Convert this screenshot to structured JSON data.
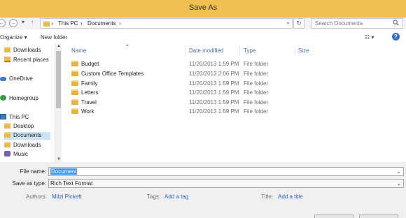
{
  "window": {
    "title": "Save As"
  },
  "nav": {
    "back_glyph": "←",
    "forward_glyph": "→",
    "recent_glyph": "▾",
    "up_glyph": "↑",
    "refresh_glyph": "↻",
    "crumbs": [
      {
        "label": "This PC"
      },
      {
        "label": "Documents"
      }
    ],
    "separator_glyph": "›",
    "dropdown_glyph": "⌄",
    "search_placeholder": "Search Documents",
    "search_icon": "search-icon"
  },
  "toolbar": {
    "organize_label": "Organize ▾",
    "new_folder_label": "New folder",
    "view_glyph": "☷ ▾",
    "help_glyph": "?"
  },
  "sidebar": {
    "items": [
      {
        "label": "Downloads",
        "icon": "folder-icon"
      },
      {
        "label": "Recent places",
        "icon": "recent-places-icon"
      },
      {
        "label": "OneDrive",
        "icon": "cloud-icon"
      },
      {
        "label": "Homegroup",
        "icon": "homegroup-icon"
      },
      {
        "label": "This PC",
        "icon": "computer-icon"
      },
      {
        "label": "Desktop",
        "icon": "folder-icon"
      },
      {
        "label": "Documents",
        "icon": "folder-icon",
        "selected": true
      },
      {
        "label": "Downloads",
        "icon": "folder-icon"
      },
      {
        "label": "Music",
        "icon": "music-icon"
      }
    ]
  },
  "filelist": {
    "columns": {
      "name": "Name",
      "date": "Date modified",
      "type": "Type",
      "size": "Size"
    },
    "sort_glyph": "▲",
    "rows": [
      {
        "name": "Budget",
        "date": "11/20/2013 1:59 PM",
        "type": "File folder"
      },
      {
        "name": "Custom Office Templates",
        "date": "11/20/2013 2:06 PM",
        "type": "File folder"
      },
      {
        "name": "Family",
        "date": "11/20/2013 1:59 PM",
        "type": "File folder"
      },
      {
        "name": "Letters",
        "date": "11/20/2013 1:59 PM",
        "type": "File folder"
      },
      {
        "name": "Travel",
        "date": "11/20/2013 1:59 PM",
        "type": "File folder"
      },
      {
        "name": "Work",
        "date": "11/20/2013 1:59 PM",
        "type": "File folder"
      }
    ]
  },
  "form": {
    "file_name_label": "File name:",
    "file_name_value": "Document",
    "save_type_label": "Save as type:",
    "save_type_value": "Rich Text Format",
    "dropdown_glyph": "⌄",
    "authors_label": "Authors:",
    "authors_value": "Mitzi Pickett",
    "tags_label": "Tags:",
    "tags_value": "Add a tag",
    "title_label": "Title:",
    "title_value": "Add a title"
  },
  "colors": {
    "title_bar": "#f0c050",
    "selection": "#3399ff",
    "link": "#2a5bd7",
    "folder": "#e6b241"
  }
}
